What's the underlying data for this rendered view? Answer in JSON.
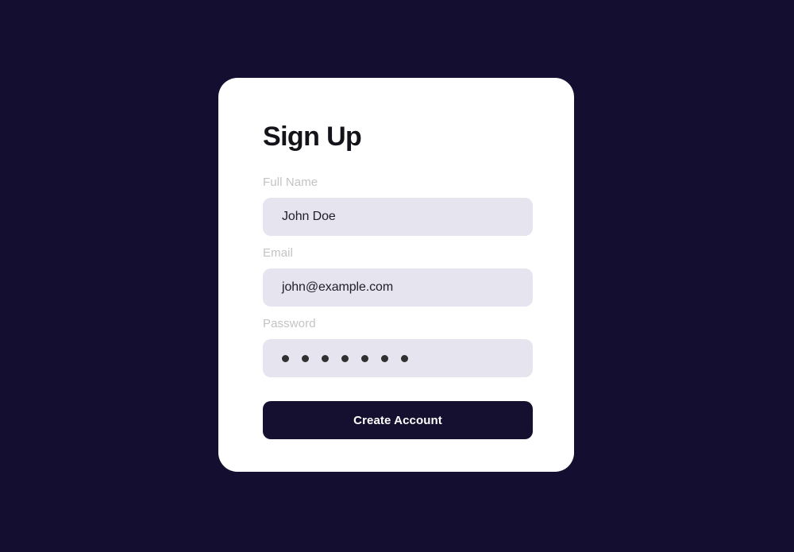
{
  "theme": {
    "page_background": "#140f30",
    "card_background": "#ffffff",
    "input_background": "#e5e4ef",
    "label_color": "#c3c3c6",
    "input_text_color": "#21212b",
    "button_background": "#150f30",
    "button_text_color": "#ffffff",
    "title_color": "#14131a",
    "password_dot_color": "#303030"
  },
  "card": {
    "title": "Sign Up",
    "fields": [
      {
        "id": "full-name",
        "label": "Full Name",
        "value": "John Doe",
        "placeholder": "Full Name",
        "type": "text"
      },
      {
        "id": "email",
        "label": "Email",
        "value": "john@example.com",
        "placeholder": "Email",
        "type": "email"
      },
      {
        "id": "password",
        "label": "Password",
        "value": "•••••••",
        "placeholder": "Password",
        "type": "password",
        "masked_character_count": 7
      }
    ],
    "submit": {
      "label": "Create Account"
    }
  }
}
